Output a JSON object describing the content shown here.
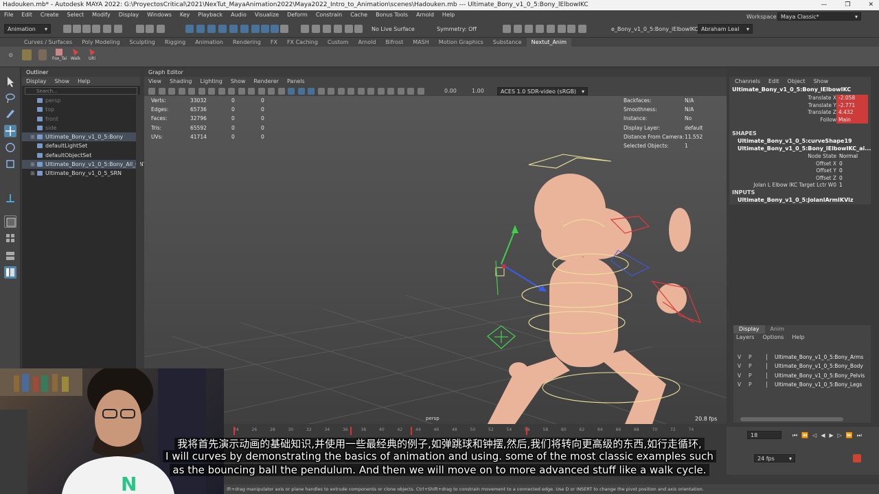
{
  "window": {
    "title": "Hadouken.mb* - Autodesk MAYA 2022: G:\\ProyectosCritical\\2021\\NexTut_MayaAnimation2022\\Maya2022_Intro_to_Animation\\scenes\\Hadouken.mb  ---  Ultimate_Bony_v1_0_5:Bony_lElbowIKC",
    "controls": [
      "—",
      "❐",
      "✕"
    ]
  },
  "menubar": [
    "File",
    "Edit",
    "Create",
    "Select",
    "Modify",
    "Display",
    "Windows",
    "Key",
    "Playback",
    "Audio",
    "Visualize",
    "Deform",
    "Constrain",
    "Cache",
    "Bonus Tools",
    "Arnold",
    "Help"
  ],
  "statusline": {
    "mode": "Animation",
    "live_surface": "No Live Surface",
    "symmetry": "Symmetry: Off",
    "selected_object": "e_Bony_v1_0_5:Bony_lElbowIKC",
    "user": "Abraham Leal",
    "workspace_label": "Workspace :",
    "workspace": "Maya Classic*"
  },
  "shelf_tabs": [
    "Curves / Surfaces",
    "Poly Modeling",
    "Sculpting",
    "Rigging",
    "Animation",
    "Rendering",
    "FX",
    "FX Caching",
    "Custom",
    "Arnold",
    "Bifrost",
    "MASH",
    "Motion Graphics",
    "Substance",
    "Nextut_Anim"
  ],
  "shelf_active": "Nextut_Anim",
  "shelf_buttons": [
    "Fox_Tai",
    "Walk",
    "Ulti"
  ],
  "outliner": {
    "title": "Outliner",
    "menu": [
      "Display",
      "Show",
      "Help"
    ],
    "search_placeholder": "Search...",
    "items": [
      {
        "label": "persp",
        "dim": true,
        "selected": false,
        "expand": ""
      },
      {
        "label": "top",
        "dim": true,
        "selected": false,
        "expand": ""
      },
      {
        "label": "front",
        "dim": true,
        "selected": false,
        "expand": ""
      },
      {
        "label": "side",
        "dim": true,
        "selected": false,
        "expand": ""
      },
      {
        "label": "Ultimate_Bony_v1_0_5:Bony",
        "dim": false,
        "selected": true,
        "expand": "⊞"
      },
      {
        "label": "defaultLightSet",
        "dim": false,
        "selected": false,
        "expand": ""
      },
      {
        "label": "defaultObjectSet",
        "dim": false,
        "selected": false,
        "expand": ""
      },
      {
        "label": "Ultimate_Bony_v1_0_5:Bony_All_CNTs",
        "dim": false,
        "selected": true,
        "expand": "⊞"
      },
      {
        "label": "Ultimate_Bony_v1_0_5_SRN",
        "dim": false,
        "selected": false,
        "expand": "⊞"
      }
    ]
  },
  "graph_editor": {
    "title": "Graph Editor",
    "menu": [
      "View",
      "Shading",
      "Lighting",
      "Show",
      "Renderer",
      "Panels"
    ],
    "exposure": "0.00",
    "gamma": "1.00",
    "color_space": "ACES 1.0 SDR-video (sRGB)"
  },
  "hud_left": [
    {
      "label": "Verts:",
      "v1": "33032",
      "v2": "0",
      "v3": "0"
    },
    {
      "label": "Edges:",
      "v1": "65736",
      "v2": "0",
      "v3": "0"
    },
    {
      "label": "Faces:",
      "v1": "32796",
      "v2": "0",
      "v3": "0"
    },
    {
      "label": "Tris:",
      "v1": "65592",
      "v2": "0",
      "v3": "0"
    },
    {
      "label": "UVs:",
      "v1": "41714",
      "v2": "0",
      "v3": "0"
    }
  ],
  "hud_right": [
    {
      "label": "Backfaces:",
      "value": "N/A"
    },
    {
      "label": "Smoothness:",
      "value": "N/A"
    },
    {
      "label": "Instance:",
      "value": "No"
    },
    {
      "label": "Display Layer:",
      "value": "default"
    },
    {
      "label": "Distance From Camera:",
      "value": "11.552"
    },
    {
      "label": "Selected Objects:",
      "value": "1"
    }
  ],
  "viewport": {
    "camera": "persp",
    "fps": "20.8 fps"
  },
  "channel_box": {
    "menu": [
      "Channels",
      "Edit",
      "Object",
      "Show"
    ],
    "object": "Ultimate_Bony_v1_0_5:Bony_lElbowIKC",
    "attrs": [
      {
        "label": "Translate X",
        "value": "-2.058",
        "keyed": true
      },
      {
        "label": "Translate Y",
        "value": "-2.771",
        "keyed": true
      },
      {
        "label": "Translate Z",
        "value": "4.432",
        "keyed": true
      },
      {
        "label": "Follow",
        "value": "Main",
        "keyed": true
      }
    ],
    "shapes_header": "SHAPES",
    "shapes": [
      "Ultimate_Bony_v1_0_5:curveShape19",
      "Ultimate_Bony_v1_0_5:Bony_lElbowIKC_ai..."
    ],
    "shape_attrs": [
      {
        "label": "Node State",
        "value": "Normal"
      },
      {
        "label": "Offset X",
        "value": "0"
      },
      {
        "label": "Offset Y",
        "value": "0"
      },
      {
        "label": "Offset Z",
        "value": "0"
      },
      {
        "label": "Jolan L Elbow IKC Target Lctr W0",
        "value": "1"
      }
    ],
    "inputs_header": "INPUTS",
    "inputs": [
      "Ultimate_Bony_v1_0_5:JolanlArmIKViz"
    ]
  },
  "layer_editor": {
    "tabs": [
      "Display",
      "Anim"
    ],
    "menu": [
      "Layers",
      "Options",
      "Help"
    ],
    "layers": [
      {
        "v": "V",
        "p": "P",
        "name": "Ultimate_Bony_v1_0_5:Bony_Arms"
      },
      {
        "v": "V",
        "p": "P",
        "name": "Ultimate_Bony_v1_0_5:Bony_Body"
      },
      {
        "v": "V",
        "p": "P",
        "name": "Ultimate_Bony_v1_0_5:Bony_Pelvis"
      },
      {
        "v": "V",
        "p": "P",
        "name": "Ultimate_Bony_v1_0_5:Bony_Legs"
      }
    ]
  },
  "timeline": {
    "ticks": [
      "24",
      "26",
      "28",
      "30",
      "32",
      "34",
      "36",
      "38",
      "40",
      "42",
      "44",
      "46",
      "48",
      "50",
      "52",
      "54",
      "56",
      "58",
      "60",
      "62",
      "64",
      "66",
      "68",
      "70",
      "72",
      "74"
    ],
    "current_frame": "18",
    "fps": "24 fps"
  },
  "helpline": "ift+drag manipulator axis or plane handles to extrude components or clone objects. Ctrl+Shift+drag to constrain movement to a connected edge. Use D or INSERT to change the pivot position and axis orientation.",
  "subtitles": {
    "zh": "我将首先演示动画的基础知识,并使用一些最经典的例子,如弹跳球和钟摆,然后,我们将转向更高级的东西,如行走循环,",
    "en1": "I will curves by demonstrating the basics of animation and using. some of the most classic examples such",
    "en2": "as the bouncing ball the pendulum. And then we will move on to more advanced stuff like a walk cycle."
  },
  "colors": {
    "selection_blue": "#454f5b",
    "key_red": "#cd3b3b",
    "ik_green": "#3fd04a",
    "ctrl_yellow": "#f0e49a",
    "skin": "#e9b49a"
  }
}
